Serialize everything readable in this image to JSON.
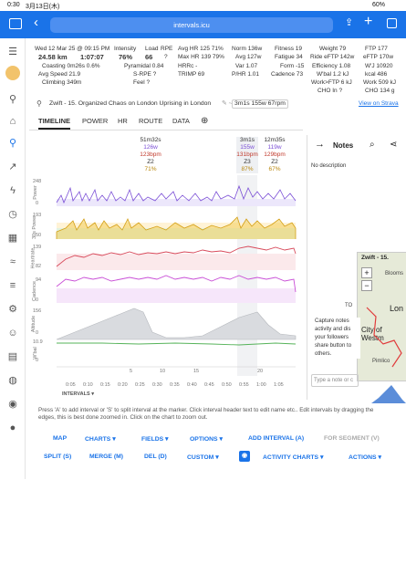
{
  "status": {
    "time": "0:30",
    "date": "3月13日(木)",
    "battery": "60%"
  },
  "browser": {
    "url": "intervals.icu"
  },
  "metrics": {
    "date": "Wed 12 Mar 25 @ 09:15 PM",
    "distance": "24.58 km",
    "duration": "1:07:07",
    "coasting": "Coasting 0m26s 0.6%",
    "avg_speed": "Avg Speed 21.9",
    "climbing": "Climbing 349m",
    "intensity_h": "Intensity",
    "intensity": "76%",
    "load_h": "Load",
    "load": "66",
    "rpe_h": "RPE",
    "rpe": "?",
    "pyramidal": "Pyramidal 0.84",
    "srpe": "S-RPE ?",
    "feel": "Feel ?",
    "avg_hr": "Avg HR 125 71%",
    "max_hr": "Max HR 139 79%",
    "hrrc": "HRRc -",
    "trimp": "TRIMP 69",
    "norm": "Norm 136w",
    "avg": "Avg 127w",
    "var": "Var 1.07",
    "phr": "P/HR 1.01",
    "fitness": "Fitness 19",
    "fatigue": "Fatigue 34",
    "form": "Form -15",
    "cadence": "Cadence 73",
    "weight": "Weight 79",
    "ride_eftp": "Ride eFTP 142w",
    "efficiency": "Efficiency 1.08",
    "wbal": "W'bal 1.2 kJ",
    "work_ftp": "Work>FTP 6 kJ",
    "cho_in": "CHO In ?",
    "ftp": "FTP 177",
    "eftp": "eFTP 170w",
    "wj": "W'J 10920",
    "kcal": "kcal 486",
    "work": "Work 509 kJ",
    "cho": "CHO 134 g"
  },
  "activity": {
    "title": "Zwift - 15. Organized Chaos on London Uprising in London",
    "interval": "3m1s 155w 67rpm",
    "strava": "View on Strava"
  },
  "tabs": [
    "TIMELINE",
    "POWER",
    "HR",
    "ROUTE",
    "DATA"
  ],
  "intervals": [
    {
      "dur": "51m32s",
      "power": "126w",
      "hr": "123bpm",
      "zone": "Z2",
      "pct": "71%"
    },
    {
      "dur": "3m1s",
      "power": "155w",
      "hr": "131bpm",
      "zone": "Z3",
      "pct": "87%"
    },
    {
      "dur": "12m35s",
      "power": "119w",
      "hr": "129bpm",
      "zone": "Z2",
      "pct": "67%"
    }
  ],
  "rows": [
    {
      "name": "Power",
      "top": "248",
      "bot": "0"
    },
    {
      "name": "30s Power",
      "top": "193",
      "bot": "50"
    },
    {
      "name": "Heartrate",
      "top": "139",
      "bot": "82"
    },
    {
      "name": "Cadence",
      "top": "94",
      "bot": "0"
    },
    {
      "name": "Altitude",
      "top": "156",
      "bot": "0"
    },
    {
      "name": "W'bal",
      "top": "10.9",
      "bot": "0"
    }
  ],
  "xticks": [
    "0:05",
    "0:10",
    "0:15",
    "0:20",
    "0:25",
    "0:30",
    "0:35",
    "0:40",
    "0:45",
    "0:50",
    "0:55",
    "1:00",
    "1:05"
  ],
  "km": [
    "5",
    "10",
    "15",
    "20"
  ],
  "intervals_label": "INTERVALS",
  "notes": {
    "title": "Notes",
    "desc": "No description",
    "capture": "Capture notes activity and dis your followers share button to others.",
    "placeholder": "Type a note or c",
    "map_title": "Zwift - 15.",
    "map_labels": [
      "Blooms",
      "Lon",
      "City of Westm",
      "Pimlico",
      "TO"
    ]
  },
  "help": "Press 'A' to add interval or 'S' to split interval at the marker. Click interval header text to edit name etc.. Edit intervals by dragging the edges, this is best done zoomed in. Click on the chart to zoom out.",
  "buttons": {
    "map": "MAP",
    "charts": "CHARTS",
    "fields": "FIELDS",
    "options": "OPTIONS",
    "add_interval": "ADD INTERVAL (A)",
    "for_segment": "FOR SEGMENT (V)",
    "split": "SPLIT (S)",
    "merge": "MERGE (M)",
    "del": "DEL (D)",
    "custom": "CUSTOM",
    "activity_charts": "ACTIVITY CHARTS",
    "actions": "ACTIONS"
  }
}
